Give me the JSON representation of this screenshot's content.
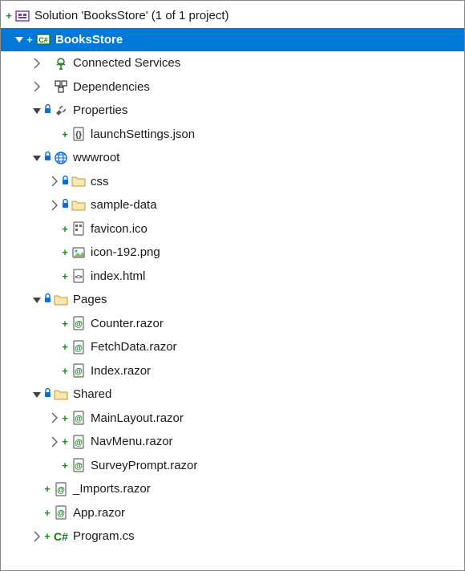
{
  "solution_label": "Solution 'BooksStore' (1 of 1 project)",
  "project_label": "BooksStore",
  "nodes": {
    "connected_services": "Connected Services",
    "dependencies": "Dependencies",
    "properties": "Properties",
    "launchsettings": "launchSettings.json",
    "wwwroot": "wwwroot",
    "css": "css",
    "sample_data": "sample-data",
    "favicon": "favicon.ico",
    "icon192": "icon-192.png",
    "indexhtml": "index.html",
    "pages": "Pages",
    "counter": "Counter.razor",
    "fetchdata": "FetchData.razor",
    "indexrazor": "Index.razor",
    "shared": "Shared",
    "mainlayout": "MainLayout.razor",
    "navmenu": "NavMenu.razor",
    "surveyprompt": "SurveyPrompt.razor",
    "imports": "_Imports.razor",
    "apprazor": "App.razor",
    "program": "Program.cs"
  }
}
